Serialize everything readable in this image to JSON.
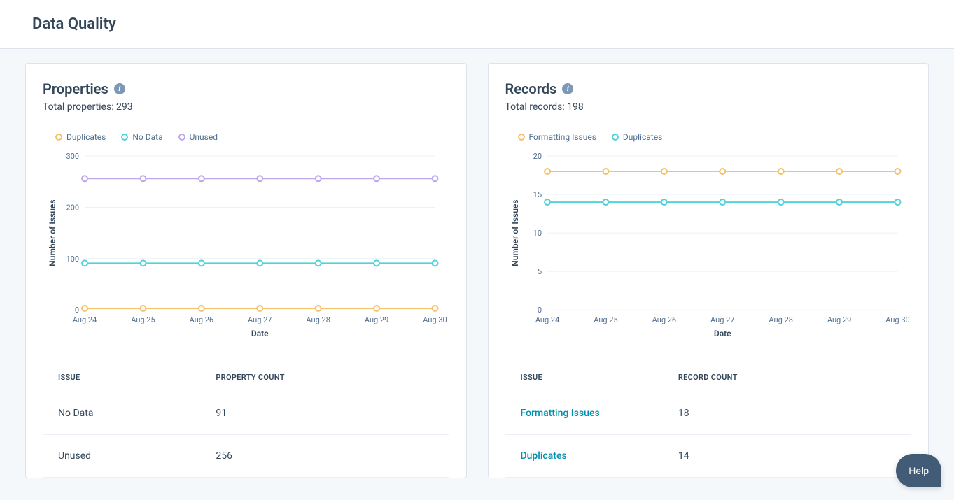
{
  "page": {
    "title": "Data Quality"
  },
  "help_label": "Help",
  "properties_card": {
    "title": "Properties",
    "subtitle": "Total properties: 293",
    "legend": {
      "duplicates": "Duplicates",
      "no_data": "No Data",
      "unused": "Unused"
    },
    "table": {
      "header_issue": "ISSUE",
      "header_count": "PROPERTY COUNT",
      "rows": [
        {
          "issue": "No Data",
          "count": "91",
          "link": false
        },
        {
          "issue": "Unused",
          "count": "256",
          "link": false
        }
      ]
    },
    "axis_x": "Date",
    "axis_y": "Number of Issues"
  },
  "records_card": {
    "title": "Records",
    "subtitle": "Total records: 198",
    "legend": {
      "formatting": "Formatting Issues",
      "duplicates": "Duplicates"
    },
    "table": {
      "header_issue": "ISSUE",
      "header_count": "RECORD COUNT",
      "rows": [
        {
          "issue": "Formatting Issues",
          "count": "18",
          "link": true
        },
        {
          "issue": "Duplicates",
          "count": "14",
          "link": true
        }
      ]
    },
    "axis_x": "Date",
    "axis_y": "Number of Issues"
  },
  "colors": {
    "orange": "#f5c26b",
    "teal": "#51d3d9",
    "purple": "#bda9ea"
  },
  "chart_data": [
    {
      "type": "line",
      "card": "properties",
      "title": "Properties",
      "xlabel": "Date",
      "ylabel": "Number of Issues",
      "ylim": [
        0,
        300
      ],
      "yticks": [
        0,
        100,
        200,
        300
      ],
      "categories": [
        "Aug 24",
        "Aug 25",
        "Aug 26",
        "Aug 27",
        "Aug 28",
        "Aug 29",
        "Aug 30"
      ],
      "series": [
        {
          "name": "Duplicates",
          "color": "#f5c26b",
          "values": [
            3,
            3,
            3,
            3,
            3,
            3,
            3
          ]
        },
        {
          "name": "No Data",
          "color": "#51d3d9",
          "values": [
            91,
            91,
            91,
            91,
            91,
            91,
            91
          ]
        },
        {
          "name": "Unused",
          "color": "#bda9ea",
          "values": [
            256,
            256,
            256,
            256,
            256,
            256,
            256
          ]
        }
      ]
    },
    {
      "type": "line",
      "card": "records",
      "title": "Records",
      "xlabel": "Date",
      "ylabel": "Number of Issues",
      "ylim": [
        0,
        20
      ],
      "yticks": [
        0,
        5,
        10,
        15,
        20
      ],
      "categories": [
        "Aug 24",
        "Aug 25",
        "Aug 26",
        "Aug 27",
        "Aug 28",
        "Aug 29",
        "Aug 30"
      ],
      "series": [
        {
          "name": "Formatting Issues",
          "color": "#f5c26b",
          "values": [
            18,
            18,
            18,
            18,
            18,
            18,
            18
          ]
        },
        {
          "name": "Duplicates",
          "color": "#51d3d9",
          "values": [
            14,
            14,
            14,
            14,
            14,
            14,
            14
          ]
        }
      ]
    }
  ]
}
